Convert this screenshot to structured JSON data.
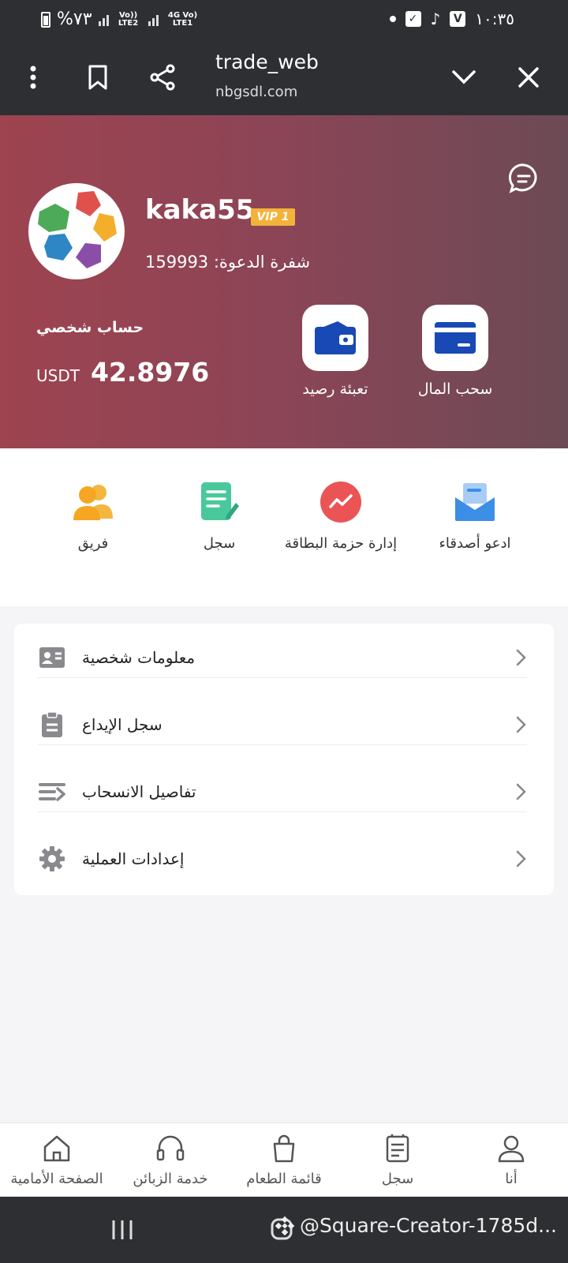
{
  "status_bar": {
    "battery": "%٧٣",
    "network1": "Vo)) LTE2",
    "network2": "4G Vo) LTE1",
    "time": "١٠:٣٥"
  },
  "browser": {
    "title": "trade_web",
    "url": "nbgsdl.com"
  },
  "profile": {
    "username": "kaka55",
    "vip": "VIP 1",
    "invite_code": "شفرة الدعوة: 159993",
    "account_label": "حساب شخصي",
    "currency": "USDT",
    "balance": "42.8976",
    "actions": [
      {
        "label": "سحب المال",
        "icon": "withdraw-card-icon"
      },
      {
        "label": "تعبئة رصيد",
        "icon": "wallet-icon"
      }
    ]
  },
  "quick_actions": [
    {
      "label": "ادعو أصدقاء",
      "icon": "invite-mail-icon"
    },
    {
      "label": "إدارة حزمة البطاقة",
      "icon": "card-package-icon"
    },
    {
      "label": "سجل",
      "icon": "record-edit-icon"
    },
    {
      "label": "فريق",
      "icon": "team-icon"
    }
  ],
  "menu": [
    {
      "label": "معلومات شخصية",
      "icon": "id-card-icon"
    },
    {
      "label": "سجل الإيداع",
      "icon": "clipboard-icon"
    },
    {
      "label": "تفاصيل الانسحاب",
      "icon": "transfer-icon"
    },
    {
      "label": "إعدادات العملية",
      "icon": "gear-icon"
    }
  ],
  "bottom_nav": [
    {
      "label": "الصفحة الأمامية",
      "icon": "home-icon"
    },
    {
      "label": "خدمة الزبائن",
      "icon": "headset-icon"
    },
    {
      "label": "قائمة الطعام",
      "icon": "bag-icon"
    },
    {
      "label": "سجل",
      "icon": "document-icon"
    },
    {
      "label": "أنا",
      "icon": "user-icon"
    }
  ],
  "watermark": "@Square-Creator-1785d...",
  "colors": {
    "header_gradient_start": "#9e4350",
    "header_gradient_end": "#6c4a55",
    "chrome": "#2e2f33",
    "vip": "#f4b23a",
    "blue": "#1849b5"
  }
}
